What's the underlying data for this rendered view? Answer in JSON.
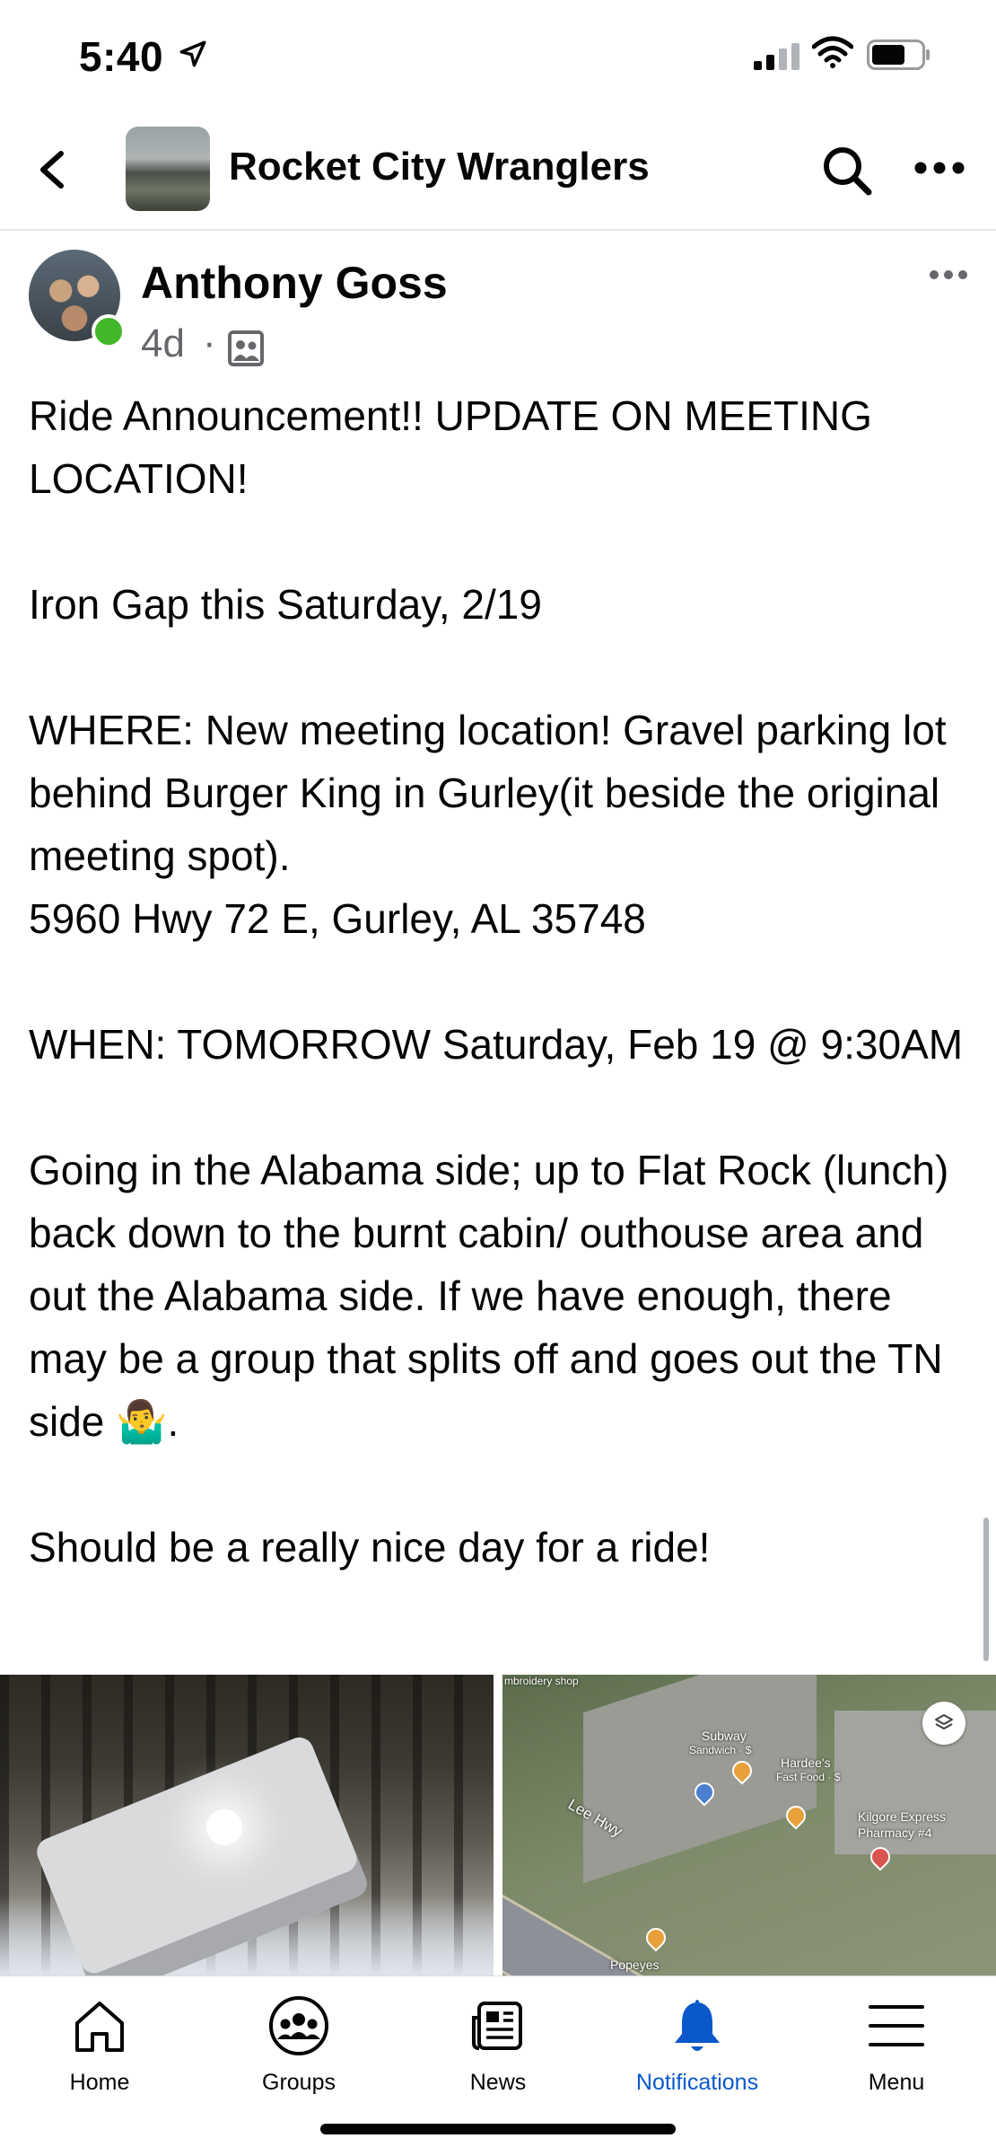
{
  "status_bar": {
    "time": "5:40",
    "icons": [
      "location-arrow-icon",
      "cellular-signal-icon",
      "wifi-icon",
      "battery-icon"
    ]
  },
  "header": {
    "group_name": "Rocket City Wranglers",
    "icons": [
      "back-chevron-icon",
      "search-icon",
      "more-horizontal-icon"
    ]
  },
  "post": {
    "author": "Anthony Goss",
    "age": "4d",
    "separator": "·",
    "audience_icon": "group-audience-icon",
    "body": [
      "Ride Announcement!! UPDATE ON MEETING LOCATION!",
      "",
      "Iron Gap this Saturday, 2/19",
      "",
      "WHERE: New meeting location! Gravel parking lot behind Burger King in Gurley(it beside the original meeting spot).",
      "5960 Hwy 72 E, Gurley, AL 35748",
      "",
      "WHEN: TOMORROW Saturday, Feb 19 @ 9:30AM",
      "",
      "Going in the Alabama side; up to Flat Rock (lunch) back down to the burnt cabin/ outhouse area and out the Alabama side. If we have enough, there may be a group that splits off and goes out the TN side 🤷‍♂️.",
      "",
      "Should be a really nice day for a ride!"
    ]
  },
  "map": {
    "labels": {
      "subway": "Subway",
      "subway_sub": "Sandwich · $",
      "hardees": "Hardee's",
      "hardees_sub": "Fast Food · $",
      "kilgore": "Kilgore Express",
      "kilgore_sub": "Pharmacy #4",
      "road": "Lee Hwy",
      "popeyes": "Popeyes",
      "top_clip": "mbroidery shop"
    }
  },
  "tabbar": {
    "tabs": [
      {
        "label": "Home",
        "icon": "home-icon"
      },
      {
        "label": "Groups",
        "icon": "groups-icon"
      },
      {
        "label": "News",
        "icon": "news-icon"
      },
      {
        "label": "Notifications",
        "icon": "bell-icon"
      },
      {
        "label": "Menu",
        "icon": "hamburger-menu-icon"
      }
    ],
    "active_tab": "Notifications",
    "active_color": "#0a58ca"
  }
}
